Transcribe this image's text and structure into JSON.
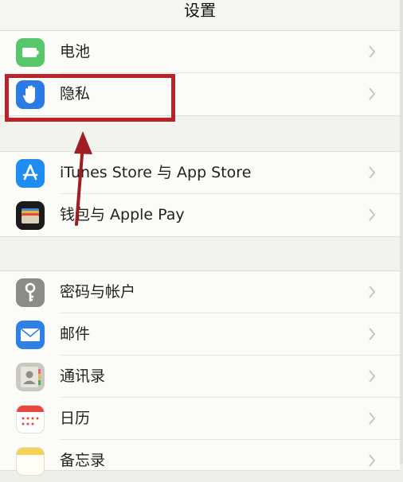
{
  "header": {
    "title": "设置"
  },
  "group1": [
    {
      "label": "电池",
      "icon": "battery-icon",
      "color": "#58c66a"
    },
    {
      "label": "隐私",
      "icon": "privacy-hand-icon",
      "color": "#2c7be5"
    }
  ],
  "group2": [
    {
      "label": "iTunes Store 与 App Store",
      "icon": "app-store-icon",
      "color": "#1e8cf0"
    },
    {
      "label": "钱包与 Apple Pay",
      "icon": "wallet-icon",
      "color": "#1b1b1b"
    }
  ],
  "group3": [
    {
      "label": "密码与帐户",
      "icon": "key-icon",
      "color": "#8c8c86"
    },
    {
      "label": "邮件",
      "icon": "mail-icon",
      "color": "#2f80e6"
    },
    {
      "label": "通讯录",
      "icon": "contacts-icon",
      "color": "#bdbdb5"
    },
    {
      "label": "日历",
      "icon": "calendar-icon",
      "color": "#ffffff"
    },
    {
      "label": "备忘录",
      "icon": "notes-icon",
      "color": "#f4d25a"
    }
  ],
  "colors": {
    "highlight": "#b9232a",
    "arrow": "#a11c22"
  }
}
